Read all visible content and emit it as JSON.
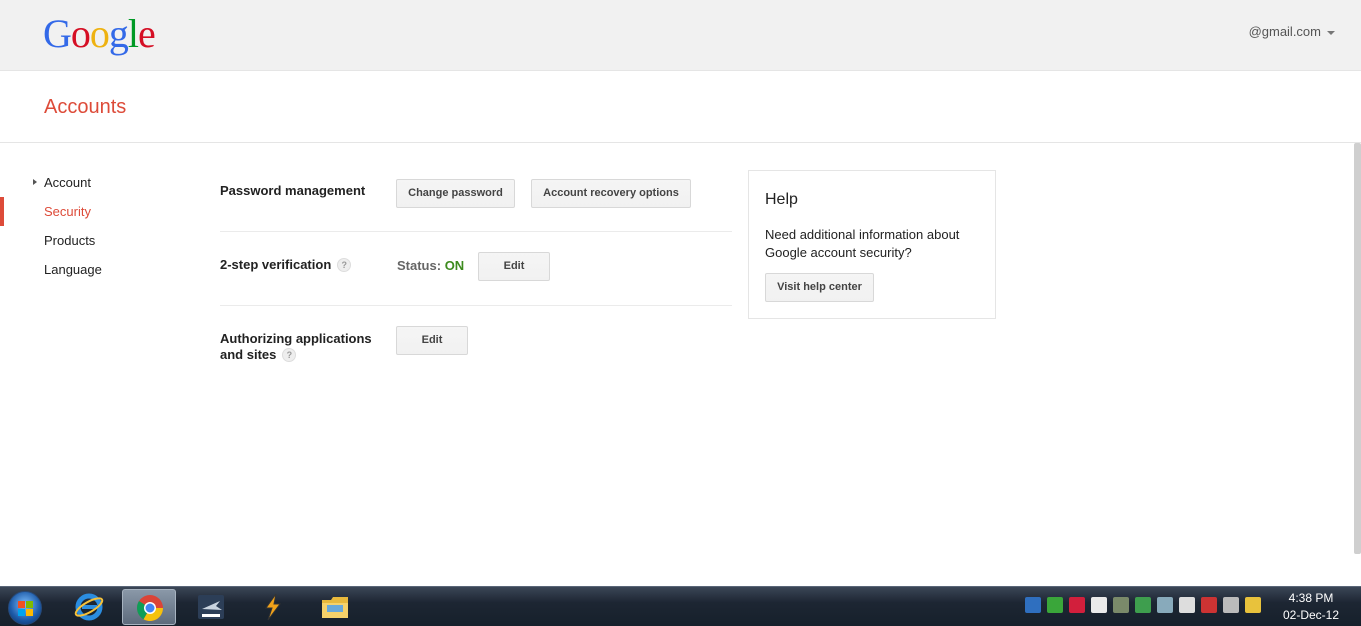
{
  "header": {
    "logo": [
      "G",
      "o",
      "o",
      "g",
      "l",
      "e"
    ],
    "logo_colors": [
      "#3369e8",
      "#d50f25",
      "#eeb211",
      "#3369e8",
      "#009925",
      "#d50f25"
    ],
    "account_email": "@gmail.com"
  },
  "page": {
    "title": "Accounts"
  },
  "sidebar": {
    "items": [
      {
        "label": "Account"
      },
      {
        "label": "Security"
      },
      {
        "label": "Products"
      },
      {
        "label": "Language"
      }
    ],
    "active_index": 1
  },
  "main": {
    "password": {
      "label": "Password management",
      "change_btn": "Change password",
      "recovery_btn": "Account recovery options"
    },
    "two_step": {
      "label": "2-step verification",
      "status_prefix": "Status:",
      "status_value": "ON",
      "edit_btn": "Edit"
    },
    "authorizing": {
      "label_line1": "Authorizing applications",
      "label_line2": "and sites",
      "edit_btn": "Edit"
    },
    "help_marker": "?"
  },
  "help_card": {
    "title": "Help",
    "text": "Need additional information about Google account security?",
    "button": "Visit help center"
  },
  "taskbar": {
    "time": "4:38 PM",
    "date": "02-Dec-12",
    "apps": [
      "internet-explorer",
      "chrome",
      "bms",
      "winamp",
      "windows-explorer"
    ]
  },
  "colors": {
    "accent_red": "#dd4b39",
    "status_green": "#3d8b1e"
  }
}
